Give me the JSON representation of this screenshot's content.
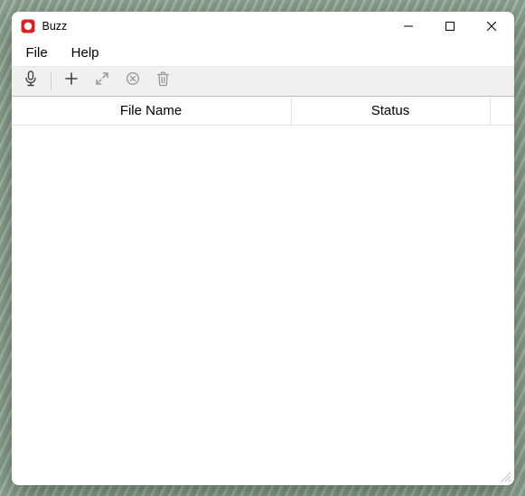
{
  "window": {
    "title": "Buzz"
  },
  "menubar": {
    "items": [
      {
        "label": "File"
      },
      {
        "label": "Help"
      }
    ]
  },
  "toolbar": {
    "icons": {
      "record": "microphone-icon",
      "add": "plus-icon",
      "expand": "expand-icon",
      "cancel": "cancel-circle-icon",
      "delete": "trash-icon"
    }
  },
  "table": {
    "columns": [
      {
        "label": "File Name"
      },
      {
        "label": "Status"
      }
    ],
    "rows": []
  }
}
